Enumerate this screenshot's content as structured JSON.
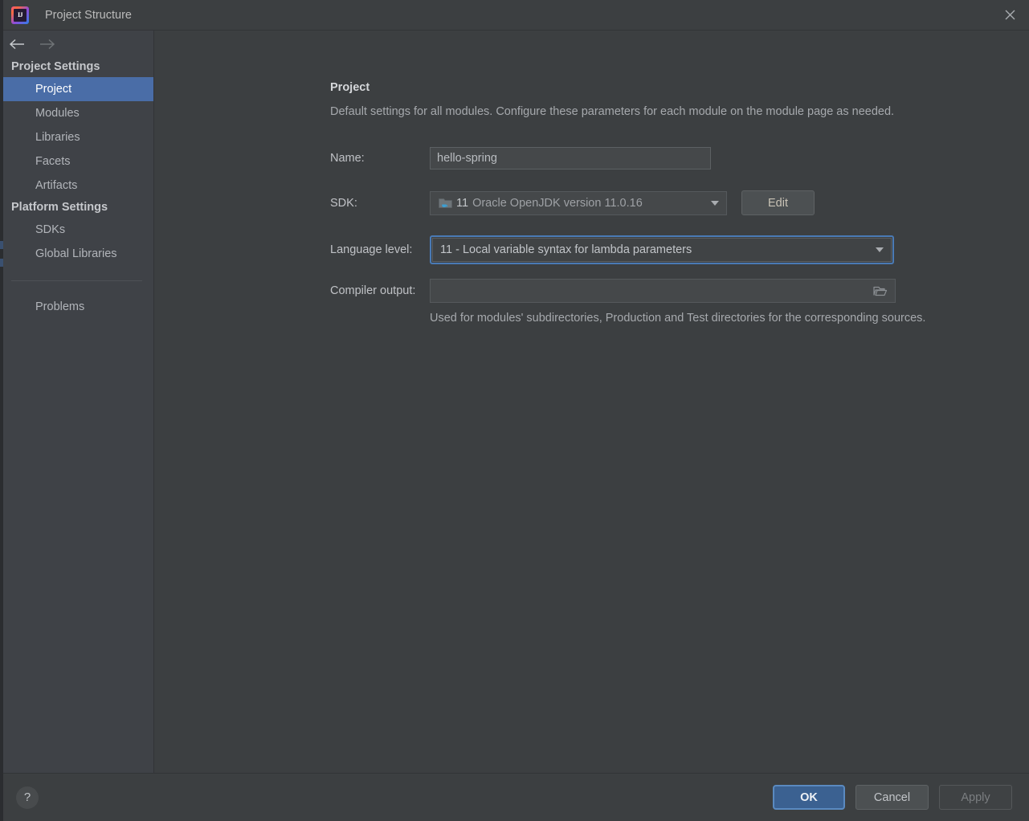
{
  "window": {
    "title": "Project Structure",
    "logo_text": "IJ",
    "logo_icon": "intellij-idea-logo",
    "close_icon": "close-icon"
  },
  "sidebar": {
    "nav": {
      "back_icon": "arrow-left-icon",
      "forward_icon": "arrow-right-icon"
    },
    "groups": [
      {
        "title": "Project Settings",
        "items": [
          {
            "label": "Project",
            "selected": true
          },
          {
            "label": "Modules",
            "selected": false
          },
          {
            "label": "Libraries",
            "selected": false
          },
          {
            "label": "Facets",
            "selected": false
          },
          {
            "label": "Artifacts",
            "selected": false
          }
        ]
      },
      {
        "title": "Platform Settings",
        "items": [
          {
            "label": "SDKs",
            "selected": false
          },
          {
            "label": "Global Libraries",
            "selected": false
          }
        ]
      }
    ],
    "problems": {
      "label": "Problems",
      "selected": false
    }
  },
  "main": {
    "heading": "Project",
    "description": "Default settings for all modules. Configure these parameters for each module on the module page as needed.",
    "fields": {
      "name": {
        "label": "Name:",
        "value": "hello-spring",
        "placeholder": ""
      },
      "sdk": {
        "label": "SDK:",
        "icon": "java-sdk-folder-icon",
        "version_badge": "11",
        "value": "Oracle OpenJDK version 11.0.16",
        "dropdown_icon": "chevron-down-icon",
        "edit_label": "Edit"
      },
      "language_level": {
        "label": "Language level:",
        "value": "11 - Local variable syntax for lambda parameters",
        "dropdown_icon": "chevron-down-icon",
        "focused": true
      },
      "compiler_output": {
        "label": "Compiler output:",
        "value": "",
        "placeholder": "",
        "browse_icon": "folder-icon",
        "hint": "Used for modules' subdirectories, Production and Test directories for the corresponding sources."
      }
    }
  },
  "footer": {
    "help_label": "?",
    "help_icon": "help-question-icon",
    "ok_label": "OK",
    "cancel_label": "Cancel",
    "apply_label": "Apply"
  },
  "colors": {
    "dialog_bg": "#3c3f41",
    "sidebar_bg": "#3f4247",
    "selection_blue": "#4a6da7",
    "focus_blue": "#4a7ab5",
    "ok_blue": "#3b6191"
  }
}
